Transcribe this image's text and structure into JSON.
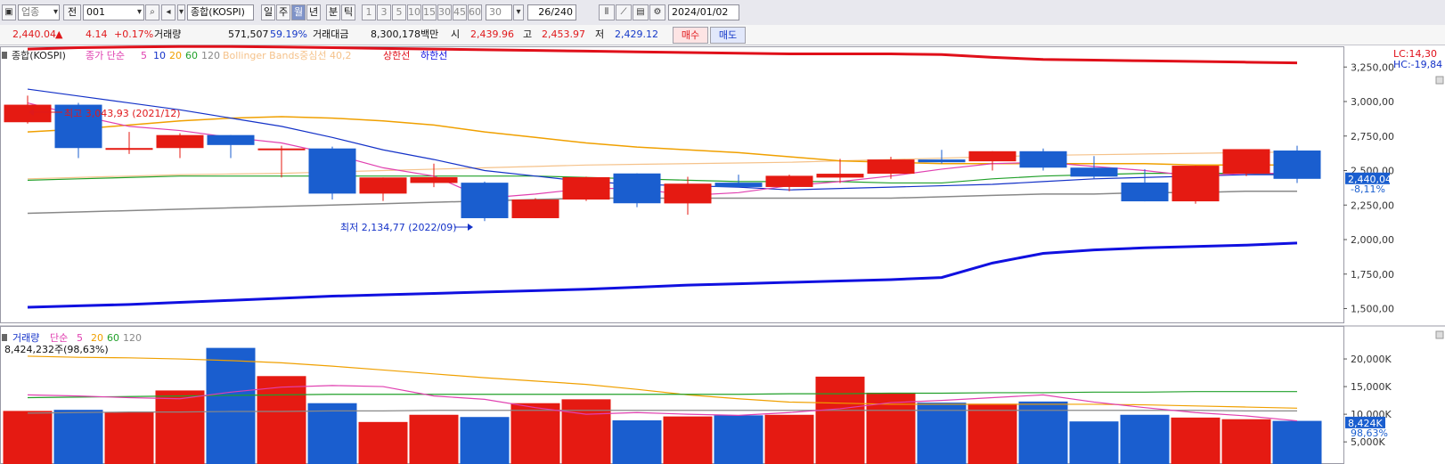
{
  "toolbar": {
    "market_select": "업종",
    "all_label": "전",
    "code_value": "001",
    "name_value": "종합(KOSPI)",
    "periods": [
      "일",
      "주",
      "월",
      "년",
      "분",
      "틱"
    ],
    "active_period": "월",
    "interval_buttons": [
      "1",
      "3",
      "5",
      "10",
      "15",
      "30",
      "45",
      "60"
    ],
    "interval_value": "30",
    "count_value": "26",
    "count_total": "/240",
    "date_value": "2024/01/02"
  },
  "quote": {
    "price": "2,440.04",
    "change_arrow": "▲",
    "change": "4.14",
    "change_pct": "+0.17%",
    "volume_label": "거래량",
    "volume": "571,507",
    "volume_ratio": "59.19%",
    "amount_label": "거래대금",
    "amount": "8,300,178백만",
    "open_label": "시",
    "open": "2,439.96",
    "high_label": "고",
    "high": "2,453.97",
    "low_label": "저",
    "low": "2,429.12",
    "buy_label": "매수",
    "sell_label": "매도"
  },
  "colors": {
    "up": "#e51a12",
    "down": "#1a5ecf",
    "ma5": "#e040b0",
    "ma10": "#1432c8",
    "ma20": "#f0a000",
    "ma60": "#21a02a",
    "ma120": "#888888",
    "bb_upper": "#e0101a",
    "bb_lower": "#1010e0",
    "bb_mid": "#f5c28a"
  },
  "chart_data": [
    {
      "type": "candlestick",
      "title": "종합(KOSPI)",
      "legend": [
        "종가 단순",
        "5",
        "10",
        "20",
        "60",
        "120",
        "Bollinger Bands중심선 40,2",
        "상한선",
        "하한선"
      ],
      "ylim": [
        1400,
        3400
      ],
      "ticks": [
        "3,250,00",
        "3,000,00",
        "2,750,00",
        "2,500,00",
        "2,250,00",
        "2,000,00",
        "1,750,00",
        "1,500,00"
      ],
      "tick_values": [
        3250,
        3000,
        2750,
        2500,
        2250,
        2000,
        1750,
        1500
      ],
      "lc_label": "LC:14,30",
      "hc_label": "HC:-19,84",
      "last_label": "2,440,04",
      "last_pct": "-8,11%",
      "max_annotation": "최고 3,043,93 (2021/12)",
      "min_annotation": "최저 2,134,77 (2022/09)",
      "candles": [
        {
          "o": 2850,
          "h": 3043,
          "l": 2840,
          "c": 2977
        },
        {
          "o": 2977,
          "h": 2990,
          "l": 2590,
          "c": 2663
        },
        {
          "o": 2663,
          "h": 2780,
          "l": 2620,
          "c": 2663
        },
        {
          "o": 2663,
          "h": 2770,
          "l": 2590,
          "c": 2757
        },
        {
          "o": 2757,
          "h": 2700,
          "l": 2590,
          "c": 2685
        },
        {
          "o": 2657,
          "h": 2680,
          "l": 2450,
          "c": 2660
        },
        {
          "o": 2660,
          "h": 2673,
          "l": 2290,
          "c": 2333
        },
        {
          "o": 2333,
          "h": 2420,
          "l": 2280,
          "c": 2450
        },
        {
          "o": 2410,
          "h": 2550,
          "l": 2380,
          "c": 2452
        },
        {
          "o": 2412,
          "h": 2420,
          "l": 2134,
          "c": 2155
        },
        {
          "o": 2155,
          "h": 2300,
          "l": 2180,
          "c": 2290
        },
        {
          "o": 2290,
          "h": 2456,
          "l": 2280,
          "c": 2452
        },
        {
          "o": 2479,
          "h": 2480,
          "l": 2235,
          "c": 2263
        },
        {
          "o": 2262,
          "h": 2455,
          "l": 2180,
          "c": 2405
        },
        {
          "o": 2412,
          "h": 2470,
          "l": 2377,
          "c": 2381
        },
        {
          "o": 2381,
          "h": 2470,
          "l": 2350,
          "c": 2462
        },
        {
          "o": 2449,
          "h": 2585,
          "l": 2410,
          "c": 2477
        },
        {
          "o": 2477,
          "h": 2600,
          "l": 2440,
          "c": 2580
        },
        {
          "o": 2580,
          "h": 2650,
          "l": 2550,
          "c": 2560
        },
        {
          "o": 2567,
          "h": 2640,
          "l": 2500,
          "c": 2640
        },
        {
          "o": 2640,
          "h": 2660,
          "l": 2500,
          "c": 2521
        },
        {
          "o": 2521,
          "h": 2605,
          "l": 2440,
          "c": 2456
        },
        {
          "o": 2413,
          "h": 2510,
          "l": 2280,
          "c": 2277
        },
        {
          "o": 2277,
          "h": 2530,
          "l": 2260,
          "c": 2535
        },
        {
          "o": 2478,
          "h": 2650,
          "l": 2460,
          "c": 2655
        },
        {
          "o": 2645,
          "h": 2680,
          "l": 2410,
          "c": 2440
        }
      ],
      "ma5": [
        2990,
        2900,
        2820,
        2790,
        2740,
        2700,
        2620,
        2520,
        2460,
        2300,
        2330,
        2370,
        2370,
        2320,
        2340,
        2390,
        2420,
        2460,
        2510,
        2550,
        2560,
        2530,
        2500,
        2460,
        2480,
        2480
      ],
      "ma10": [
        3090,
        3040,
        2990,
        2940,
        2880,
        2820,
        2740,
        2650,
        2580,
        2500,
        2460,
        2420,
        2400,
        2390,
        2380,
        2360,
        2370,
        2380,
        2390,
        2400,
        2420,
        2440,
        2450,
        2460,
        2470,
        2470
      ],
      "ma20": [
        2780,
        2800,
        2830,
        2860,
        2880,
        2890,
        2880,
        2860,
        2830,
        2780,
        2740,
        2700,
        2670,
        2650,
        2630,
        2600,
        2570,
        2560,
        2550,
        2550,
        2550,
        2550,
        2550,
        2540,
        2540,
        2540
      ],
      "ma60": [
        2430,
        2440,
        2450,
        2460,
        2460,
        2460,
        2460,
        2460,
        2460,
        2460,
        2460,
        2450,
        2440,
        2430,
        2420,
        2420,
        2420,
        2410,
        2410,
        2440,
        2460,
        2470,
        2480,
        2480,
        2480,
        2470
      ],
      "ma120": [
        2190,
        2200,
        2210,
        2220,
        2230,
        2240,
        2250,
        2260,
        2270,
        2280,
        2290,
        2300,
        2300,
        2300,
        2300,
        2300,
        2300,
        2300,
        2310,
        2320,
        2330,
        2330,
        2340,
        2340,
        2350,
        2350
      ],
      "bb_upper": [
        3380,
        3390,
        3395,
        3398,
        3398,
        3395,
        3390,
        3385,
        3380,
        3375,
        3370,
        3365,
        3360,
        3355,
        3350,
        3345,
        3345,
        3345,
        3340,
        3320,
        3305,
        3300,
        3295,
        3290,
        3285,
        3280
      ],
      "bb_lower": [
        1510,
        1520,
        1530,
        1545,
        1560,
        1575,
        1590,
        1600,
        1610,
        1620,
        1630,
        1640,
        1655,
        1670,
        1680,
        1690,
        1700,
        1710,
        1725,
        1830,
        1900,
        1925,
        1940,
        1950,
        1960,
        1975
      ],
      "bb_mid": [
        2440,
        2450,
        2460,
        2470,
        2475,
        2480,
        2490,
        2500,
        2510,
        2520,
        2530,
        2540,
        2545,
        2550,
        2555,
        2560,
        2570,
        2580,
        2590,
        2600,
        2610,
        2615,
        2620,
        2625,
        2630,
        2635
      ]
    },
    {
      "type": "bar",
      "title": "거래량",
      "legend": [
        "단순",
        "5",
        "20",
        "60",
        "120"
      ],
      "ylim": [
        1000,
        25000
      ],
      "ticks": [
        "20,000K",
        "15,000K",
        "10,000K",
        "5,000K"
      ],
      "tick_values": [
        20000,
        15000,
        10000,
        5000
      ],
      "info_label": "8,424,232주(98,63%)",
      "last_label": "8,424K",
      "last_pct": "98,63%",
      "values": [
        10600,
        10800,
        10400,
        14300,
        22000,
        16900,
        12000,
        8600,
        9900,
        9500,
        12000,
        12700,
        8900,
        9600,
        9800,
        9900,
        16800,
        13900,
        12100,
        11900,
        12300,
        8700,
        9900,
        9400,
        9100,
        8800
      ],
      "ma5": [
        13500,
        13300,
        13000,
        12800,
        14000,
        14900,
        15200,
        15000,
        13300,
        12700,
        11200,
        10000,
        10300,
        10000,
        9800,
        10300,
        11000,
        12100,
        12500,
        13000,
        13500,
        12200,
        11200,
        10300,
        9700,
        8800
      ],
      "ma20": [
        20500,
        20300,
        20200,
        20000,
        19700,
        19300,
        18700,
        18000,
        17300,
        16600,
        16000,
        15400,
        14500,
        13500,
        12800,
        12200,
        12000,
        11800,
        11800,
        11800,
        11800,
        11800,
        11700,
        11500,
        11300,
        11100
      ],
      "ma60": [
        13000,
        13100,
        13200,
        13300,
        13400,
        13500,
        13600,
        13600,
        13600,
        13600,
        13600,
        13600,
        13600,
        13600,
        13600,
        13700,
        13700,
        13800,
        13800,
        13900,
        13900,
        14000,
        14000,
        14100,
        14100,
        14100
      ],
      "ma120": [
        10200,
        10300,
        10400,
        10400,
        10500,
        10500,
        10600,
        10600,
        10700,
        10700,
        10700,
        10700,
        10700,
        10700,
        10700,
        10700,
        10700,
        10700,
        10700,
        10700,
        10700,
        10700,
        10700,
        10700,
        10600,
        10600
      ]
    }
  ]
}
